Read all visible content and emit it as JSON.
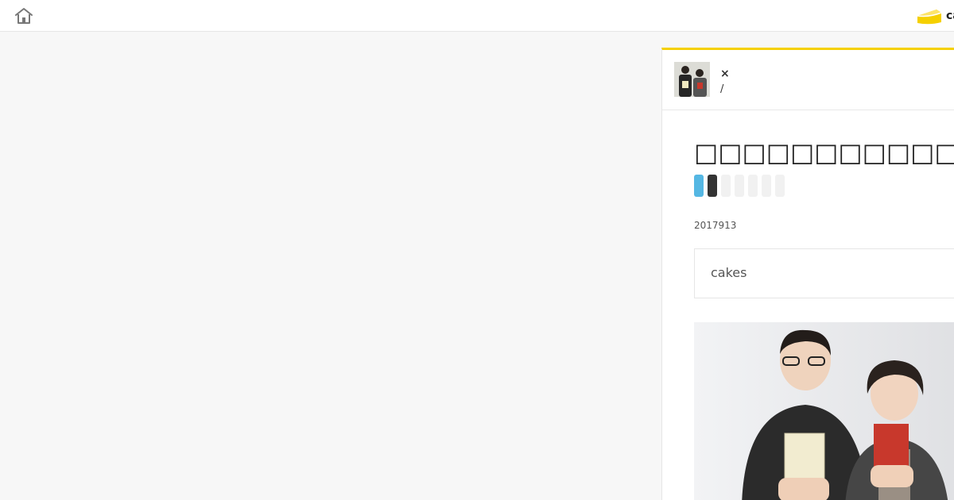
{
  "header": {
    "home_icon": "home-icon",
    "brand_text": "cakes",
    "brand_logo": "cake-slice-logo",
    "brand_color": "#f5d000"
  },
  "article": {
    "accent_color": "#f5d000",
    "author": {
      "cross_mark": "×",
      "separator": "/"
    },
    "title": "□□□□□□□□□□□□□□□□□□□□",
    "share_buttons": [
      {
        "name": "twitter",
        "color": "#55b7e3"
      },
      {
        "name": "dark",
        "color": "#333333"
      },
      {
        "name": "blank",
        "color": "#f1f1f1"
      },
      {
        "name": "blank",
        "color": "#f1f1f1"
      },
      {
        "name": "blank",
        "color": "#f1f1f1"
      },
      {
        "name": "blank",
        "color": "#f1f1f1"
      },
      {
        "name": "blank",
        "color": "#f1f1f1"
      }
    ],
    "date": "2017913",
    "source": "cakes"
  }
}
